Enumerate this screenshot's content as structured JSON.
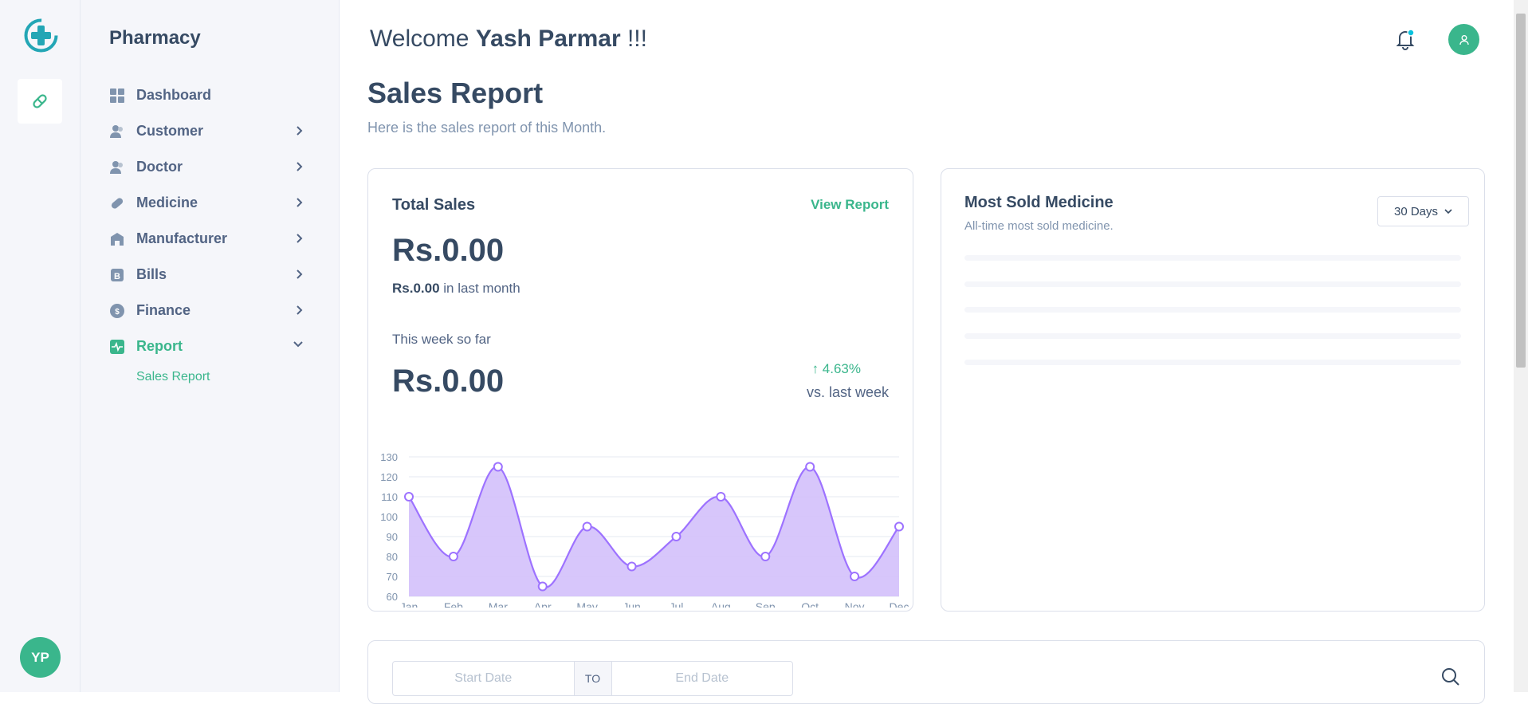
{
  "app": {
    "brand": "Pharmacy"
  },
  "sidebar": {
    "items": [
      {
        "label": "Dashboard"
      },
      {
        "label": "Customer"
      },
      {
        "label": "Doctor"
      },
      {
        "label": "Medicine"
      },
      {
        "label": "Manufacturer"
      },
      {
        "label": "Bills"
      },
      {
        "label": "Finance"
      },
      {
        "label": "Report"
      }
    ],
    "sub_items": [
      {
        "label": "Sales Report"
      }
    ],
    "user_initials": "YP"
  },
  "header": {
    "welcome_prefix": "Welcome",
    "user_name": "Yash Parmar",
    "welcome_suffix": "!!!"
  },
  "page": {
    "title": "Sales Report",
    "subtitle": "Here is the sales report of this Month."
  },
  "total_sales": {
    "title": "Total Sales",
    "view_report": "View Report",
    "amount": "Rs.0.00",
    "last_month_value": "Rs.0.00",
    "last_month_text": "in last month",
    "week_label": "This week so far",
    "week_amount": "Rs.0.00",
    "change": "4.63%",
    "change_label": "vs. last week"
  },
  "most_sold": {
    "title": "Most Sold Medicine",
    "subtitle": "All-time most sold medicine.",
    "range": "30 Days"
  },
  "filter": {
    "start_placeholder": "Start Date",
    "to_label": "TO",
    "end_placeholder": "End Date"
  },
  "colors": {
    "accent": "#3ab68c",
    "chart_line": "#9d72ff",
    "chart_fill": "#d3c0fb"
  },
  "chart_data": {
    "type": "area",
    "categories": [
      "Jan",
      "Feb",
      "Mar",
      "Apr",
      "May",
      "Jun",
      "Jul",
      "Aug",
      "Sep",
      "Oct",
      "Nov",
      "Dec"
    ],
    "values": [
      110,
      80,
      125,
      65,
      95,
      75,
      90,
      110,
      80,
      125,
      70,
      95
    ],
    "ylim": [
      60,
      130
    ],
    "yticks": [
      60,
      70,
      80,
      90,
      100,
      110,
      120,
      130
    ],
    "grid": true
  }
}
